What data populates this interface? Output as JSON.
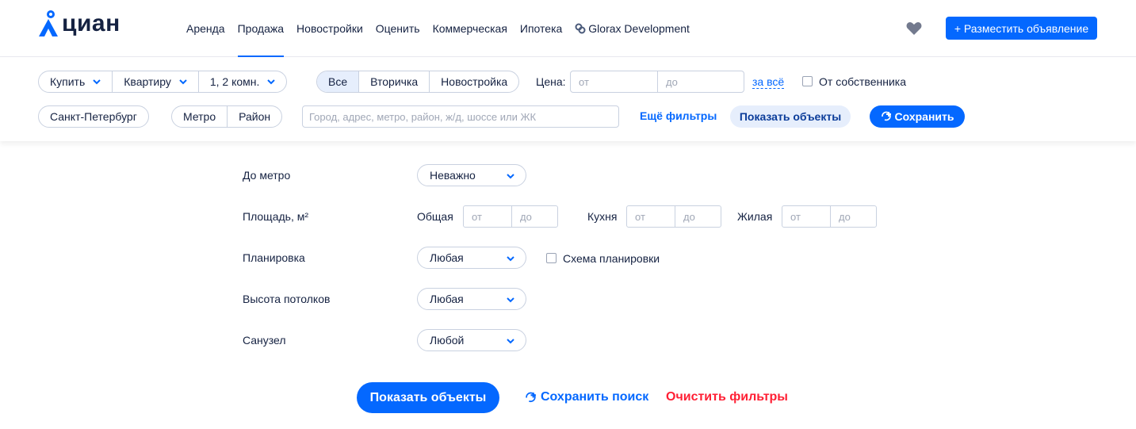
{
  "header": {
    "logo_text": "циан",
    "nav": [
      {
        "label": "Аренда",
        "active": false
      },
      {
        "label": "Продажа",
        "active": true
      },
      {
        "label": "Новостройки",
        "active": false
      },
      {
        "label": "Оценить",
        "active": false
      },
      {
        "label": "Коммерческая",
        "active": false
      },
      {
        "label": "Ипотека",
        "active": false
      },
      {
        "label": "Glorax Development",
        "active": false
      }
    ],
    "favorites_icon": "heart-icon",
    "place_ad_label": "+ Разместить объявление"
  },
  "filters": {
    "deal_type": "Купить",
    "object_type": "Квартиру",
    "rooms": "1, 2 комн.",
    "segment": [
      "Все",
      "Вторичка",
      "Новостройка"
    ],
    "segment_selected": "Все",
    "price_label": "Цена:",
    "price_from_placeholder": "от",
    "price_to_placeholder": "до",
    "price_unit_link": "за всё",
    "owner_label": "От собственника",
    "city": "Санкт-Петербург",
    "geo_options": [
      "Метро",
      "Район"
    ],
    "address_placeholder": "Город, адрес, метро, район, ж/д, шоссе или ЖК",
    "more_filters": "Ещё фильтры",
    "show_objects": "Показать объекты",
    "save_label": "Сохранить"
  },
  "extra": {
    "metro_label": "До метро",
    "metro_value": "Неважно",
    "area_label": "Площадь, м²",
    "area_total": "Общая",
    "area_kitchen": "Кухня",
    "area_living": "Жилая",
    "from": "от",
    "to": "до",
    "layout_label": "Планировка",
    "layout_value": "Любая",
    "layout_scheme": "Схема планировки",
    "ceiling_label": "Высота потолков",
    "ceiling_value": "Любая",
    "bathroom_label": "Санузел",
    "bathroom_value": "Любой"
  },
  "bottom": {
    "show_objects": "Показать объекты",
    "save_search": "Сохранить поиск",
    "clear_filters": "Очистить фильтры"
  },
  "colors": {
    "accent": "#0468ff",
    "danger": "#ff1f34",
    "text": "#152242",
    "selected_bg": "#e6eefc"
  }
}
